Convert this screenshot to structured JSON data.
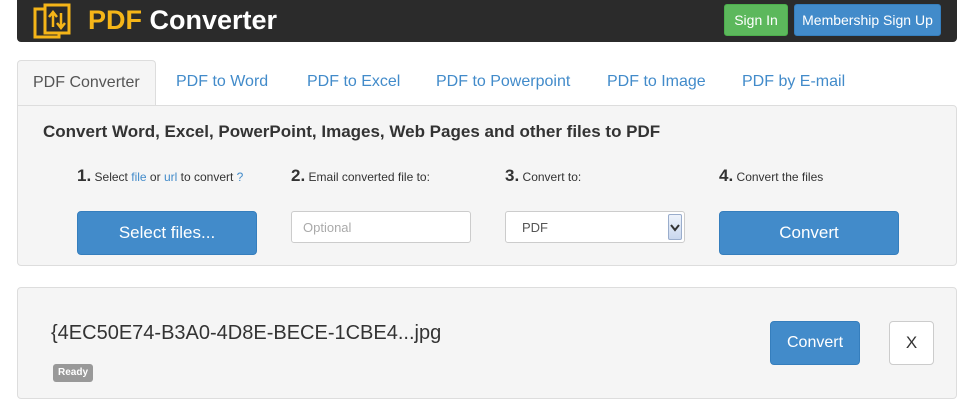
{
  "header": {
    "logo_pdf": "PDF",
    "logo_rest": "Converter",
    "signin_label": "Sign In",
    "membership_label": "Membership Sign Up",
    "brand_color": "#f5b518"
  },
  "tabs": [
    {
      "label": "PDF Converter",
      "active": true
    },
    {
      "label": "PDF to Word"
    },
    {
      "label": "PDF to Excel"
    },
    {
      "label": "PDF to Powerpoint"
    },
    {
      "label": "PDF to Image"
    },
    {
      "label": "PDF by E-mail"
    }
  ],
  "converter": {
    "title": "Convert Word, Excel, PowerPoint, Images, Web Pages and other files to PDF",
    "step1": {
      "num": "1.",
      "pre": "Select",
      "file_link": "file",
      "or": "or",
      "url_link": "url",
      "post": "to convert",
      "help": "?"
    },
    "step2": {
      "num": "2.",
      "text": "Email converted file to:"
    },
    "step3": {
      "num": "3.",
      "text": "Convert to:"
    },
    "step4": {
      "num": "4.",
      "text": "Convert the files"
    },
    "select_files_label": "Select files...",
    "email_placeholder": "Optional",
    "convert_to_value": "PDF",
    "convert_label": "Convert"
  },
  "file": {
    "name": "{4EC50E74-B3A0-4D8E-BECE-1CBE4...jpg",
    "status": "Ready",
    "convert_label": "Convert",
    "remove_label": "X"
  },
  "colors": {
    "primary": "#428bca",
    "success": "#5cb85c",
    "header_bg": "#2b2b2b"
  }
}
